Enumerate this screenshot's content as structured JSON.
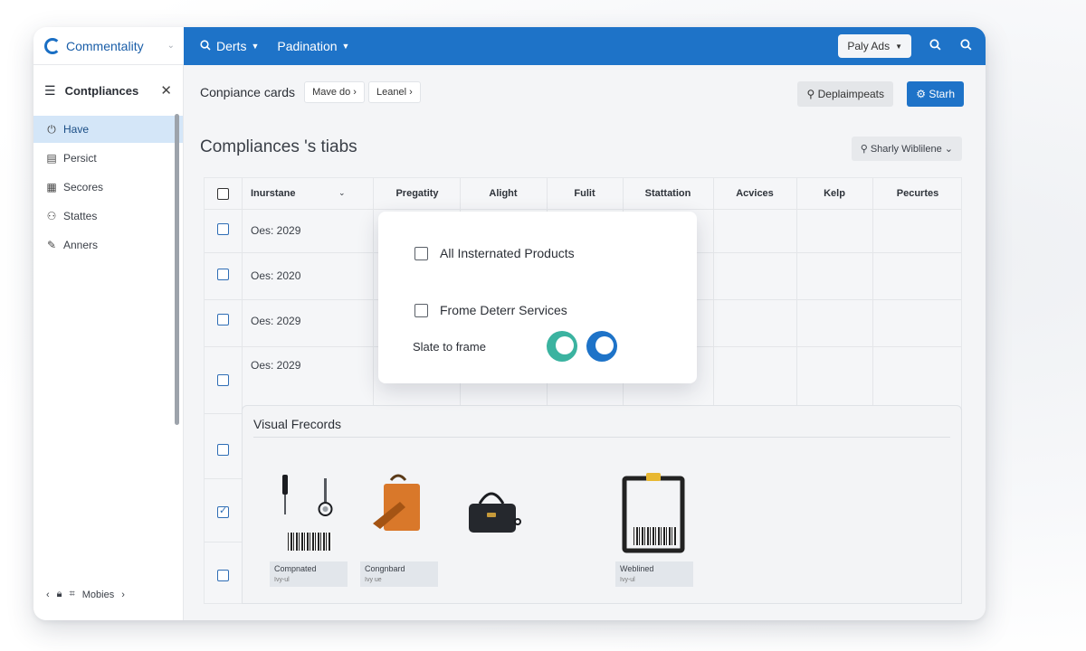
{
  "brand": {
    "name": "Commentality"
  },
  "topbar": {
    "nav": [
      {
        "label": "Derts",
        "icon": "search-icon"
      },
      {
        "label": "Padination"
      }
    ],
    "play_button": "Paly Ads"
  },
  "sidebar": {
    "title": "Contpliances",
    "items": [
      {
        "label": "Have",
        "icon": "power-icon",
        "active": true
      },
      {
        "label": "Persict",
        "icon": "table-icon"
      },
      {
        "label": "Secores",
        "icon": "grid-icon"
      },
      {
        "label": "Stattes",
        "icon": "people-icon"
      },
      {
        "label": "Anners",
        "icon": "pencil-icon"
      }
    ],
    "footer_label": "Mobies"
  },
  "main": {
    "breadcrumb_title": "Conpiance cards",
    "chips": [
      "Mave do ›",
      "Leanel ›"
    ],
    "deploy_button": "Deplaimpeats",
    "start_button": "Starh",
    "section_title": "Compliances 's tiabs",
    "share_button": "Sharly Wiblilene",
    "columns": [
      "Inurstane",
      "Pregatity",
      "Alight",
      "Fulit",
      "Stattation",
      "Acvices",
      "Kelp",
      "Pecurtes"
    ],
    "rows": [
      {
        "value": "Oes: 2029",
        "checked": false
      },
      {
        "value": "Oes: 2020",
        "checked": false
      },
      {
        "value": "Oes: 2029",
        "checked": false
      },
      {
        "value": "Oes: 2029",
        "checked": false
      },
      {
        "value": "",
        "checked": false
      },
      {
        "value": "",
        "checked": true
      },
      {
        "value": "",
        "checked": false
      }
    ]
  },
  "popover": {
    "option1": "All Insternated Products",
    "option2": "Frome Deterr Services",
    "toggle_label": "Slate to frame",
    "toggle_colors": [
      "#3bb3a0",
      "#1e73c8"
    ]
  },
  "visual_records": {
    "title": "Visual Frecords",
    "cards": [
      {
        "label": "Compnated",
        "sub": "Ivy-ul",
        "icon": "tools-icon"
      },
      {
        "label": "Congnbard",
        "sub": "Ivy ue",
        "icon": "shopping-bag-icon"
      },
      {
        "label": "",
        "sub": "",
        "icon": "handbag-icon"
      },
      {
        "label": "Weblined",
        "sub": "Ivy-ul",
        "icon": "clipboard-icon"
      }
    ]
  },
  "colors": {
    "accent": "#1e73c8",
    "active_bg": "#d4e6f8"
  }
}
